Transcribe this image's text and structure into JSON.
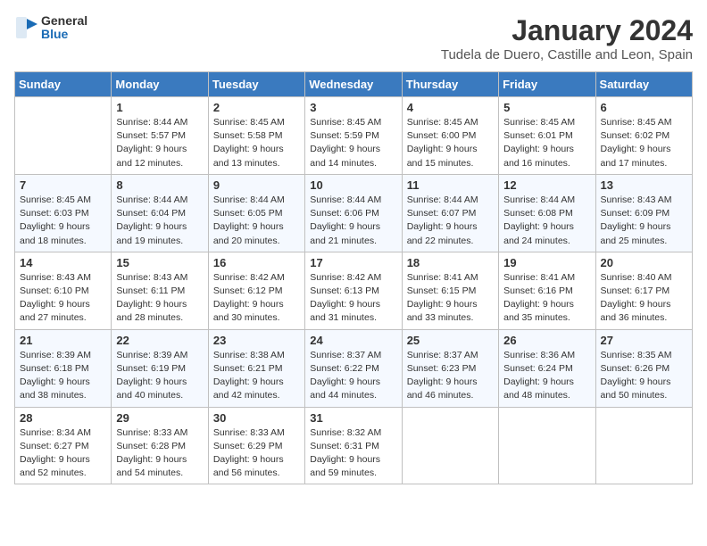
{
  "header": {
    "logo_general": "General",
    "logo_blue": "Blue",
    "month": "January 2024",
    "location": "Tudela de Duero, Castille and Leon, Spain"
  },
  "weekdays": [
    "Sunday",
    "Monday",
    "Tuesday",
    "Wednesday",
    "Thursday",
    "Friday",
    "Saturday"
  ],
  "weeks": [
    [
      {
        "day": "",
        "empty": true
      },
      {
        "day": "1",
        "sunrise": "Sunrise: 8:44 AM",
        "sunset": "Sunset: 5:57 PM",
        "daylight": "Daylight: 9 hours and 12 minutes."
      },
      {
        "day": "2",
        "sunrise": "Sunrise: 8:45 AM",
        "sunset": "Sunset: 5:58 PM",
        "daylight": "Daylight: 9 hours and 13 minutes."
      },
      {
        "day": "3",
        "sunrise": "Sunrise: 8:45 AM",
        "sunset": "Sunset: 5:59 PM",
        "daylight": "Daylight: 9 hours and 14 minutes."
      },
      {
        "day": "4",
        "sunrise": "Sunrise: 8:45 AM",
        "sunset": "Sunset: 6:00 PM",
        "daylight": "Daylight: 9 hours and 15 minutes."
      },
      {
        "day": "5",
        "sunrise": "Sunrise: 8:45 AM",
        "sunset": "Sunset: 6:01 PM",
        "daylight": "Daylight: 9 hours and 16 minutes."
      },
      {
        "day": "6",
        "sunrise": "Sunrise: 8:45 AM",
        "sunset": "Sunset: 6:02 PM",
        "daylight": "Daylight: 9 hours and 17 minutes."
      }
    ],
    [
      {
        "day": "7",
        "sunrise": "Sunrise: 8:45 AM",
        "sunset": "Sunset: 6:03 PM",
        "daylight": "Daylight: 9 hours and 18 minutes."
      },
      {
        "day": "8",
        "sunrise": "Sunrise: 8:44 AM",
        "sunset": "Sunset: 6:04 PM",
        "daylight": "Daylight: 9 hours and 19 minutes."
      },
      {
        "day": "9",
        "sunrise": "Sunrise: 8:44 AM",
        "sunset": "Sunset: 6:05 PM",
        "daylight": "Daylight: 9 hours and 20 minutes."
      },
      {
        "day": "10",
        "sunrise": "Sunrise: 8:44 AM",
        "sunset": "Sunset: 6:06 PM",
        "daylight": "Daylight: 9 hours and 21 minutes."
      },
      {
        "day": "11",
        "sunrise": "Sunrise: 8:44 AM",
        "sunset": "Sunset: 6:07 PM",
        "daylight": "Daylight: 9 hours and 22 minutes."
      },
      {
        "day": "12",
        "sunrise": "Sunrise: 8:44 AM",
        "sunset": "Sunset: 6:08 PM",
        "daylight": "Daylight: 9 hours and 24 minutes."
      },
      {
        "day": "13",
        "sunrise": "Sunrise: 8:43 AM",
        "sunset": "Sunset: 6:09 PM",
        "daylight": "Daylight: 9 hours and 25 minutes."
      }
    ],
    [
      {
        "day": "14",
        "sunrise": "Sunrise: 8:43 AM",
        "sunset": "Sunset: 6:10 PM",
        "daylight": "Daylight: 9 hours and 27 minutes."
      },
      {
        "day": "15",
        "sunrise": "Sunrise: 8:43 AM",
        "sunset": "Sunset: 6:11 PM",
        "daylight": "Daylight: 9 hours and 28 minutes."
      },
      {
        "day": "16",
        "sunrise": "Sunrise: 8:42 AM",
        "sunset": "Sunset: 6:12 PM",
        "daylight": "Daylight: 9 hours and 30 minutes."
      },
      {
        "day": "17",
        "sunrise": "Sunrise: 8:42 AM",
        "sunset": "Sunset: 6:13 PM",
        "daylight": "Daylight: 9 hours and 31 minutes."
      },
      {
        "day": "18",
        "sunrise": "Sunrise: 8:41 AM",
        "sunset": "Sunset: 6:15 PM",
        "daylight": "Daylight: 9 hours and 33 minutes."
      },
      {
        "day": "19",
        "sunrise": "Sunrise: 8:41 AM",
        "sunset": "Sunset: 6:16 PM",
        "daylight": "Daylight: 9 hours and 35 minutes."
      },
      {
        "day": "20",
        "sunrise": "Sunrise: 8:40 AM",
        "sunset": "Sunset: 6:17 PM",
        "daylight": "Daylight: 9 hours and 36 minutes."
      }
    ],
    [
      {
        "day": "21",
        "sunrise": "Sunrise: 8:39 AM",
        "sunset": "Sunset: 6:18 PM",
        "daylight": "Daylight: 9 hours and 38 minutes."
      },
      {
        "day": "22",
        "sunrise": "Sunrise: 8:39 AM",
        "sunset": "Sunset: 6:19 PM",
        "daylight": "Daylight: 9 hours and 40 minutes."
      },
      {
        "day": "23",
        "sunrise": "Sunrise: 8:38 AM",
        "sunset": "Sunset: 6:21 PM",
        "daylight": "Daylight: 9 hours and 42 minutes."
      },
      {
        "day": "24",
        "sunrise": "Sunrise: 8:37 AM",
        "sunset": "Sunset: 6:22 PM",
        "daylight": "Daylight: 9 hours and 44 minutes."
      },
      {
        "day": "25",
        "sunrise": "Sunrise: 8:37 AM",
        "sunset": "Sunset: 6:23 PM",
        "daylight": "Daylight: 9 hours and 46 minutes."
      },
      {
        "day": "26",
        "sunrise": "Sunrise: 8:36 AM",
        "sunset": "Sunset: 6:24 PM",
        "daylight": "Daylight: 9 hours and 48 minutes."
      },
      {
        "day": "27",
        "sunrise": "Sunrise: 8:35 AM",
        "sunset": "Sunset: 6:26 PM",
        "daylight": "Daylight: 9 hours and 50 minutes."
      }
    ],
    [
      {
        "day": "28",
        "sunrise": "Sunrise: 8:34 AM",
        "sunset": "Sunset: 6:27 PM",
        "daylight": "Daylight: 9 hours and 52 minutes."
      },
      {
        "day": "29",
        "sunrise": "Sunrise: 8:33 AM",
        "sunset": "Sunset: 6:28 PM",
        "daylight": "Daylight: 9 hours and 54 minutes."
      },
      {
        "day": "30",
        "sunrise": "Sunrise: 8:33 AM",
        "sunset": "Sunset: 6:29 PM",
        "daylight": "Daylight: 9 hours and 56 minutes."
      },
      {
        "day": "31",
        "sunrise": "Sunrise: 8:32 AM",
        "sunset": "Sunset: 6:31 PM",
        "daylight": "Daylight: 9 hours and 59 minutes."
      },
      {
        "day": "",
        "empty": true
      },
      {
        "day": "",
        "empty": true
      },
      {
        "day": "",
        "empty": true
      }
    ]
  ]
}
